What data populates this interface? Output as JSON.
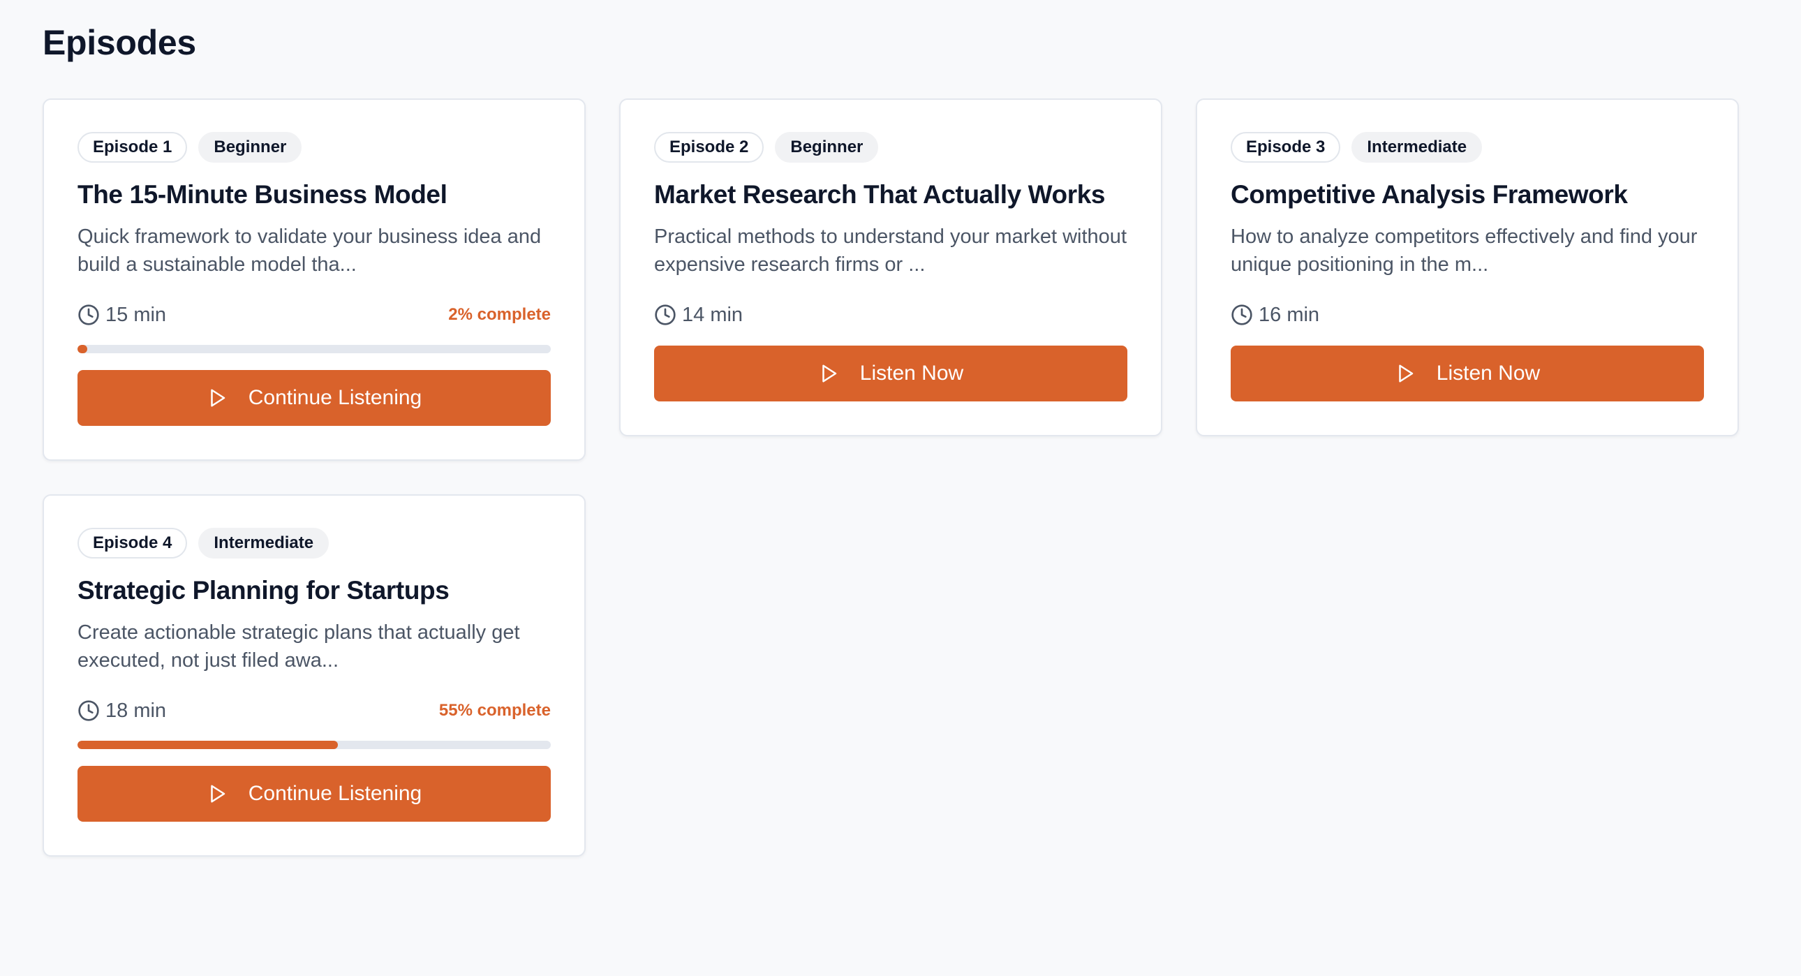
{
  "page": {
    "title": "Episodes"
  },
  "colors": {
    "accent": "#d9622b",
    "track": "#e3e7ee",
    "background": "#f8f9fb"
  },
  "episodes": [
    {
      "episode_label": "Episode 1",
      "level": "Beginner",
      "title": "The 15-Minute Business Model",
      "description": "Quick framework to validate your business idea and build a sustainable model tha...",
      "duration": "15 min",
      "progress_label": "2% complete",
      "progress": 0.02,
      "button_label": "Continue Listening",
      "button_icon": "play-icon",
      "duration_icon": "clock-icon"
    },
    {
      "episode_label": "Episode 2",
      "level": "Beginner",
      "title": "Market Research That Actually Works",
      "description": "Practical methods to understand your market without expensive research firms or ...",
      "duration": "14 min",
      "button_label": "Listen Now",
      "button_icon": "play-icon",
      "duration_icon": "clock-icon"
    },
    {
      "episode_label": "Episode 3",
      "level": "Intermediate",
      "title": "Competitive Analysis Framework",
      "description": "How to analyze competitors effectively and find your unique positioning in the m...",
      "duration": "16 min",
      "button_label": "Listen Now",
      "button_icon": "play-icon",
      "duration_icon": "clock-icon"
    },
    {
      "episode_label": "Episode 4",
      "level": "Intermediate",
      "title": "Strategic Planning for Startups",
      "description": "Create actionable strategic plans that actually get executed, not just filed awa...",
      "duration": "18 min",
      "progress_label": "55% complete",
      "progress": 0.55,
      "button_label": "Continue Listening",
      "button_icon": "play-icon",
      "duration_icon": "clock-icon"
    }
  ]
}
